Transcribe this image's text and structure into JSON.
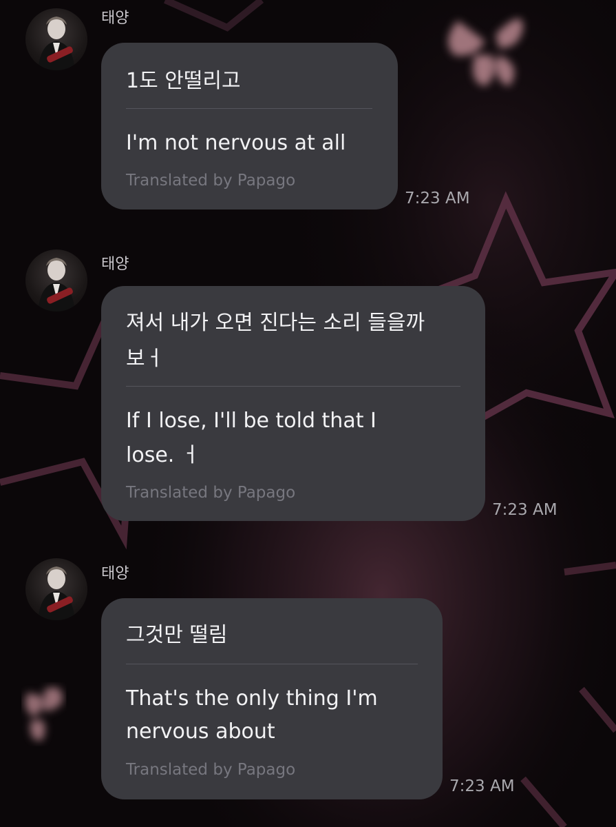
{
  "messages": [
    {
      "sender": "태양",
      "original": "1도 안떨리고",
      "translation": "I'm not nervous at all",
      "credit": "Translated by Papago",
      "time": "7:23 AM"
    },
    {
      "sender": "태양",
      "original_line1": "져서 내가 오면 진다는 소리 들을까",
      "original_line2": "보ㅓ",
      "translation_line1": "If I lose, I'll be told that I",
      "translation_line2": "lose. ㅓ",
      "credit": "Translated by Papago",
      "time": "7:23 AM"
    },
    {
      "sender": "태양",
      "original": "그것만 떨림",
      "translation_line1": "That's the only thing I'm",
      "translation_line2": "nervous about",
      "credit": "Translated by Papago",
      "time": "7:23 AM"
    }
  ],
  "colors": {
    "background": "#0b0709",
    "bubble": "#3a3a3f",
    "star_outline": "#5a2f42",
    "butterfly": "#b9878f"
  },
  "icons": [
    "avatar-icon",
    "star-shape",
    "butterfly-shape"
  ]
}
